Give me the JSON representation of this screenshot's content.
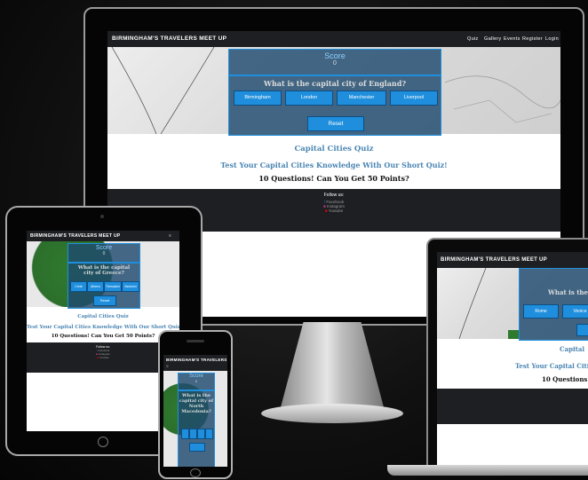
{
  "brand": "BIRMINGHAM'S TRAVELERS MEET UP",
  "nav": [
    "Quiz",
    "Gallery",
    "Events",
    "Register",
    "Login"
  ],
  "score_label": "Score",
  "score_value": "0",
  "question": "What is the capital city of England?",
  "answers": [
    "Birmingham",
    "London",
    "Manchester",
    "Liverpool"
  ],
  "reset_label": "Reset",
  "quiz_title": "Capital Cities Quiz",
  "tagline": "Test Your Capital Cities Knowledge With Our Short Quiz!",
  "points": "10 Questions! Can You Get 50 Points?",
  "footer_heading": "Follow us:",
  "socials": [
    "Facebook",
    "Instagram",
    "Youtube"
  ],
  "tablet": {
    "question": "What is the capital city of Greece?",
    "answers": [
      "Crete",
      "Athens",
      "Thessalon",
      "Santorini"
    ]
  },
  "phone": {
    "brand": "BIRMINGHAM'S TRAVELERS",
    "question": "What is the capital city of North Macedonia?"
  },
  "laptop": {
    "brand": "BIRMINGHAM'S TRAVELERS MEET UP",
    "question": "What is the c",
    "answers": [
      "Rome",
      "Venice"
    ],
    "quiz_title": "Capital",
    "tagline": "Test Your Capital Cities K",
    "points": "10 Questions! Ca"
  },
  "colors": {
    "accent": "#1f8fdd",
    "dark_bar": "#1d1f22",
    "map_green": "#2f7a2f"
  }
}
